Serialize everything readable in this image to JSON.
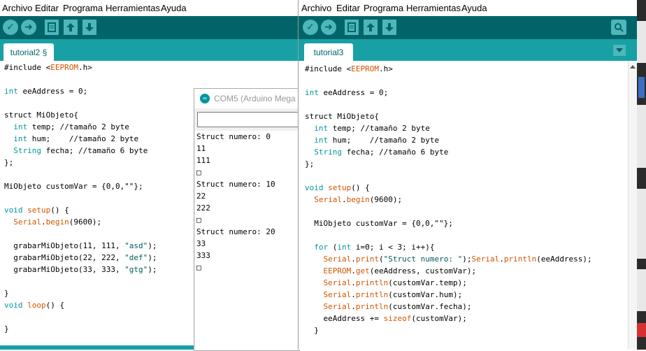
{
  "left_window": {
    "menu": [
      "Archivo",
      "Editar",
      "Programa",
      "Herramientas",
      "Ayuda"
    ],
    "tab_label": "tutorial2 §",
    "toolbar_icons": [
      "verify-icon",
      "upload-icon",
      "new-icon",
      "open-icon",
      "save-icon"
    ]
  },
  "right_window": {
    "menu": [
      "Archivo",
      "Editar",
      "Programa",
      "Herramientas",
      "Ayuda"
    ],
    "tab_label": "tutorial3",
    "toolbar_icons": [
      "verify-icon",
      "upload-icon",
      "new-icon",
      "open-icon",
      "save-icon",
      "serial-monitor-icon",
      "tab-menu-icon"
    ]
  },
  "serial_monitor": {
    "title": "COM5 (Arduino Mega",
    "output": [
      "Struct numero: 0",
      "11",
      "111",
      "□",
      "Struct numero: 10",
      "22",
      "222",
      "□",
      "Struct numero: 20",
      "33",
      "333",
      "□"
    ]
  },
  "left_code": [
    [
      {
        "t": "#include <",
        "c": ""
      },
      {
        "t": "EEPROM",
        "c": "fn"
      },
      {
        "t": ".h>",
        "c": ""
      }
    ],
    [],
    [
      {
        "t": "int",
        "c": "kw"
      },
      {
        "t": " eeAddress = 0;",
        "c": ""
      }
    ],
    [],
    [
      {
        "t": "struct MiObjeto{",
        "c": ""
      }
    ],
    [
      {
        "t": "  ",
        "c": ""
      },
      {
        "t": "int",
        "c": "kw"
      },
      {
        "t": " temp; //tamaño 2 byte",
        "c": ""
      }
    ],
    [
      {
        "t": "  ",
        "c": ""
      },
      {
        "t": "int",
        "c": "kw"
      },
      {
        "t": " hum;    //tamaño 2 byte",
        "c": ""
      }
    ],
    [
      {
        "t": "  ",
        "c": ""
      },
      {
        "t": "String",
        "c": "kw"
      },
      {
        "t": " fecha; //tamaño 6 byte",
        "c": ""
      }
    ],
    [
      {
        "t": "};",
        "c": ""
      }
    ],
    [],
    [
      {
        "t": "MiObjeto customVar = {0,0,\"\"};",
        "c": ""
      }
    ],
    [],
    [
      {
        "t": "void",
        "c": "kw"
      },
      {
        "t": " ",
        "c": ""
      },
      {
        "t": "setup",
        "c": "fn"
      },
      {
        "t": "() {",
        "c": ""
      }
    ],
    [
      {
        "t": "  ",
        "c": ""
      },
      {
        "t": "Serial",
        "c": "fn"
      },
      {
        "t": ".",
        "c": ""
      },
      {
        "t": "begin",
        "c": "fn"
      },
      {
        "t": "(9600);",
        "c": ""
      }
    ],
    [],
    [
      {
        "t": "  grabarMiObjeto(11, 111, ",
        "c": ""
      },
      {
        "t": "\"asd\"",
        "c": "str"
      },
      {
        "t": ");",
        "c": ""
      }
    ],
    [
      {
        "t": "  grabarMiObjeto(22, 222, ",
        "c": ""
      },
      {
        "t": "\"def\"",
        "c": "str"
      },
      {
        "t": ");",
        "c": ""
      }
    ],
    [
      {
        "t": "  grabarMiObjeto(33, 333, ",
        "c": ""
      },
      {
        "t": "\"gtg\"",
        "c": "str"
      },
      {
        "t": ");",
        "c": ""
      }
    ],
    [],
    [
      {
        "t": "}",
        "c": ""
      }
    ],
    [
      {
        "t": "void",
        "c": "kw"
      },
      {
        "t": " ",
        "c": ""
      },
      {
        "t": "loop",
        "c": "fn"
      },
      {
        "t": "() {",
        "c": ""
      }
    ],
    [],
    [
      {
        "t": "}",
        "c": ""
      }
    ]
  ],
  "right_code": [
    [
      {
        "t": "#include <",
        "c": ""
      },
      {
        "t": "EEPROM",
        "c": "fn"
      },
      {
        "t": ".h>",
        "c": ""
      }
    ],
    [],
    [
      {
        "t": "int",
        "c": "kw"
      },
      {
        "t": " eeAddress = 0;",
        "c": ""
      }
    ],
    [],
    [
      {
        "t": "struct MiObjeto{",
        "c": ""
      }
    ],
    [
      {
        "t": "  ",
        "c": ""
      },
      {
        "t": "int",
        "c": "kw"
      },
      {
        "t": " temp; //tamaño 2 byte",
        "c": ""
      }
    ],
    [
      {
        "t": "  ",
        "c": ""
      },
      {
        "t": "int",
        "c": "kw"
      },
      {
        "t": " hum;    //tamaño 2 byte",
        "c": ""
      }
    ],
    [
      {
        "t": "  ",
        "c": ""
      },
      {
        "t": "String",
        "c": "kw"
      },
      {
        "t": " fecha; //tamaño 6 byte",
        "c": ""
      }
    ],
    [
      {
        "t": "};",
        "c": ""
      }
    ],
    [],
    [
      {
        "t": "void",
        "c": "kw"
      },
      {
        "t": " ",
        "c": ""
      },
      {
        "t": "setup",
        "c": "fn"
      },
      {
        "t": "() {",
        "c": ""
      }
    ],
    [
      {
        "t": "  ",
        "c": ""
      },
      {
        "t": "Serial",
        "c": "fn"
      },
      {
        "t": ".",
        "c": ""
      },
      {
        "t": "begin",
        "c": "fn"
      },
      {
        "t": "(9600);",
        "c": ""
      }
    ],
    [],
    [
      {
        "t": "  MiObjeto customVar = {0,0,\"\"};",
        "c": ""
      }
    ],
    [],
    [
      {
        "t": "  ",
        "c": ""
      },
      {
        "t": "for",
        "c": "kw"
      },
      {
        "t": " (",
        "c": ""
      },
      {
        "t": "int",
        "c": "kw"
      },
      {
        "t": " i=0; i < 3; i++){",
        "c": ""
      }
    ],
    [
      {
        "t": "    ",
        "c": ""
      },
      {
        "t": "Serial",
        "c": "fn"
      },
      {
        "t": ".",
        "c": ""
      },
      {
        "t": "print",
        "c": "fn"
      },
      {
        "t": "(",
        "c": ""
      },
      {
        "t": "\"Struct numero: \"",
        "c": "str"
      },
      {
        "t": ");",
        "c": ""
      },
      {
        "t": "Serial",
        "c": "fn"
      },
      {
        "t": ".",
        "c": ""
      },
      {
        "t": "println",
        "c": "fn"
      },
      {
        "t": "(eeAddress);",
        "c": ""
      }
    ],
    [
      {
        "t": "    ",
        "c": ""
      },
      {
        "t": "EEPROM",
        "c": "fn"
      },
      {
        "t": ".",
        "c": ""
      },
      {
        "t": "get",
        "c": "fn"
      },
      {
        "t": "(eeAddress, customVar);",
        "c": ""
      }
    ],
    [
      {
        "t": "    ",
        "c": ""
      },
      {
        "t": "Serial",
        "c": "fn"
      },
      {
        "t": ".",
        "c": ""
      },
      {
        "t": "println",
        "c": "fn"
      },
      {
        "t": "(customVar.temp);",
        "c": ""
      }
    ],
    [
      {
        "t": "    ",
        "c": ""
      },
      {
        "t": "Serial",
        "c": "fn"
      },
      {
        "t": ".",
        "c": ""
      },
      {
        "t": "println",
        "c": "fn"
      },
      {
        "t": "(customVar.hum);",
        "c": ""
      }
    ],
    [
      {
        "t": "    ",
        "c": ""
      },
      {
        "t": "Serial",
        "c": "fn"
      },
      {
        "t": ".",
        "c": ""
      },
      {
        "t": "println",
        "c": "fn"
      },
      {
        "t": "(customVar.fecha);",
        "c": ""
      }
    ],
    [
      {
        "t": "    eeAddress += ",
        "c": ""
      },
      {
        "t": "sizeof",
        "c": "fn"
      },
      {
        "t": "(customVar);",
        "c": ""
      }
    ],
    [
      {
        "t": "  }",
        "c": ""
      }
    ]
  ],
  "colors": {
    "toolbar": "#006468",
    "tabbar": "#17a1a5",
    "button": "#4db7bb",
    "keyword": "#00979c",
    "function": "#d35400"
  }
}
